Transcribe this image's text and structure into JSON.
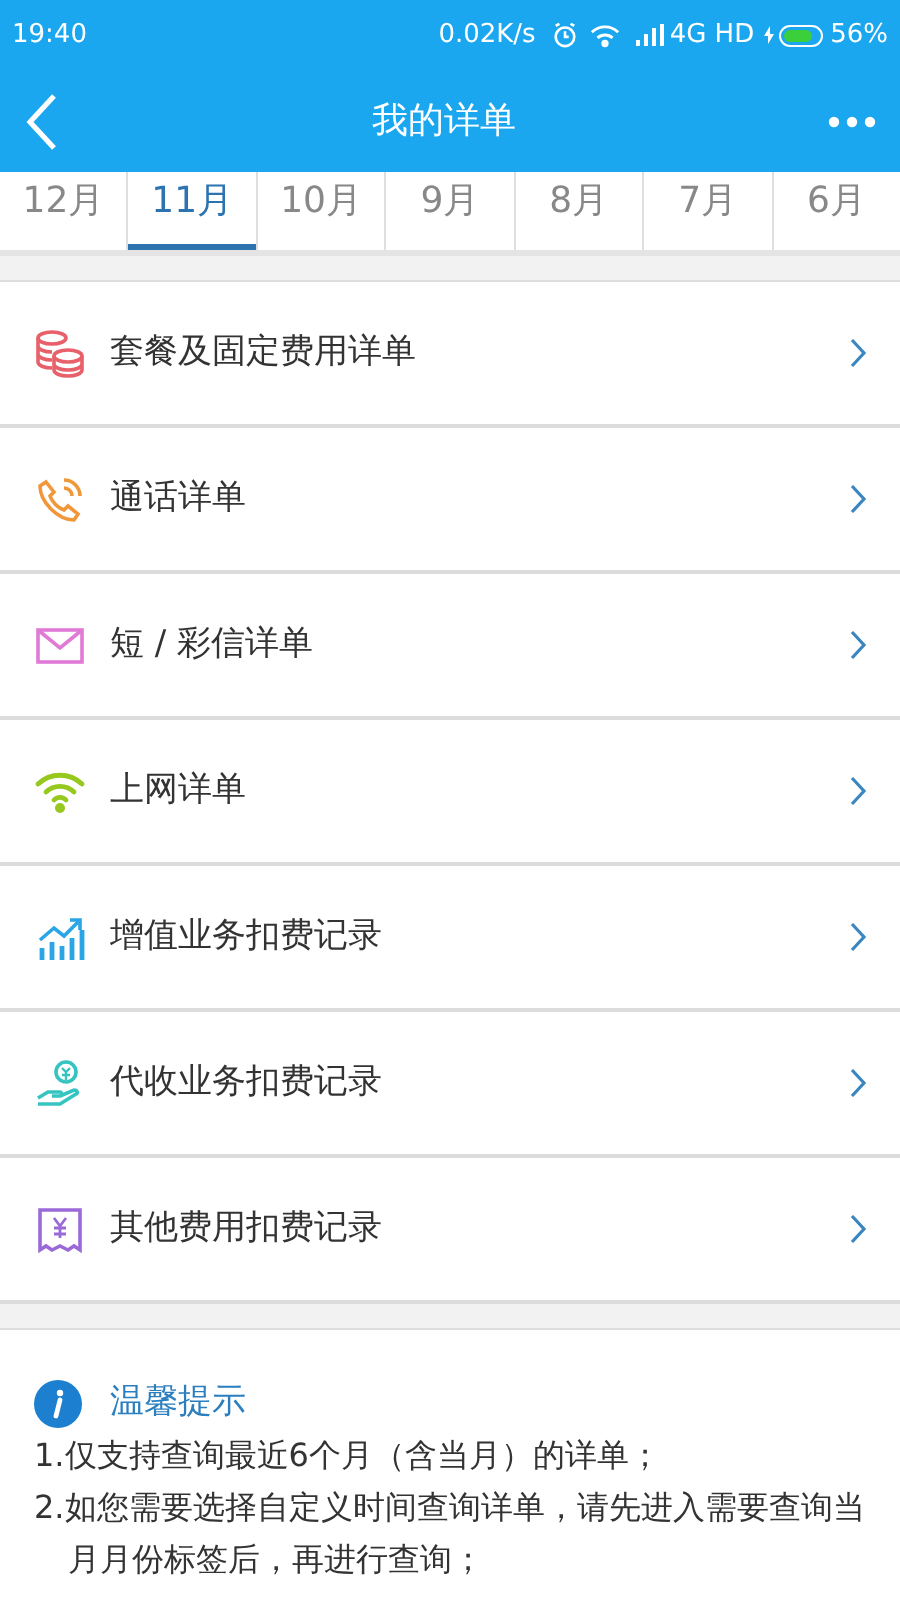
{
  "status_bar": {
    "time": "19:40",
    "speed": "0.02K/s",
    "network": "4G HD",
    "battery": "56%"
  },
  "app_bar": {
    "title": "我的详单"
  },
  "tabs": [
    {
      "label": "12月",
      "selected": false
    },
    {
      "label": "11月",
      "selected": true
    },
    {
      "label": "10月",
      "selected": false
    },
    {
      "label": "9月",
      "selected": false
    },
    {
      "label": "8月",
      "selected": false
    },
    {
      "label": "7月",
      "selected": false
    },
    {
      "label": "6月",
      "selected": false
    }
  ],
  "items": [
    {
      "kind": "coins",
      "color": "#e8606a",
      "label": "套餐及固定费用详单"
    },
    {
      "kind": "phone",
      "color": "#f0973a",
      "label": "通话详单"
    },
    {
      "kind": "mail",
      "color": "#e07ad6",
      "label": "短 / 彩信详单"
    },
    {
      "kind": "wifi",
      "color": "#96c81e",
      "label": "上网详单"
    },
    {
      "kind": "chart",
      "color": "#2aa6e6",
      "label": "增值业务扣费记录"
    },
    {
      "kind": "hand",
      "color": "#36c4c0",
      "label": "代收业务扣费记录"
    },
    {
      "kind": "receipt",
      "color": "#9a6ad8",
      "label": "其他费用扣费记录"
    }
  ],
  "tips": {
    "title": "温馨提示",
    "lines": [
      "1.仅支持查询最近6个月（含当月）的详单；",
      "2.如您需要选择自定义时间查询详单，请先进入需要查询当月月份标签后，再进行查询；"
    ]
  }
}
